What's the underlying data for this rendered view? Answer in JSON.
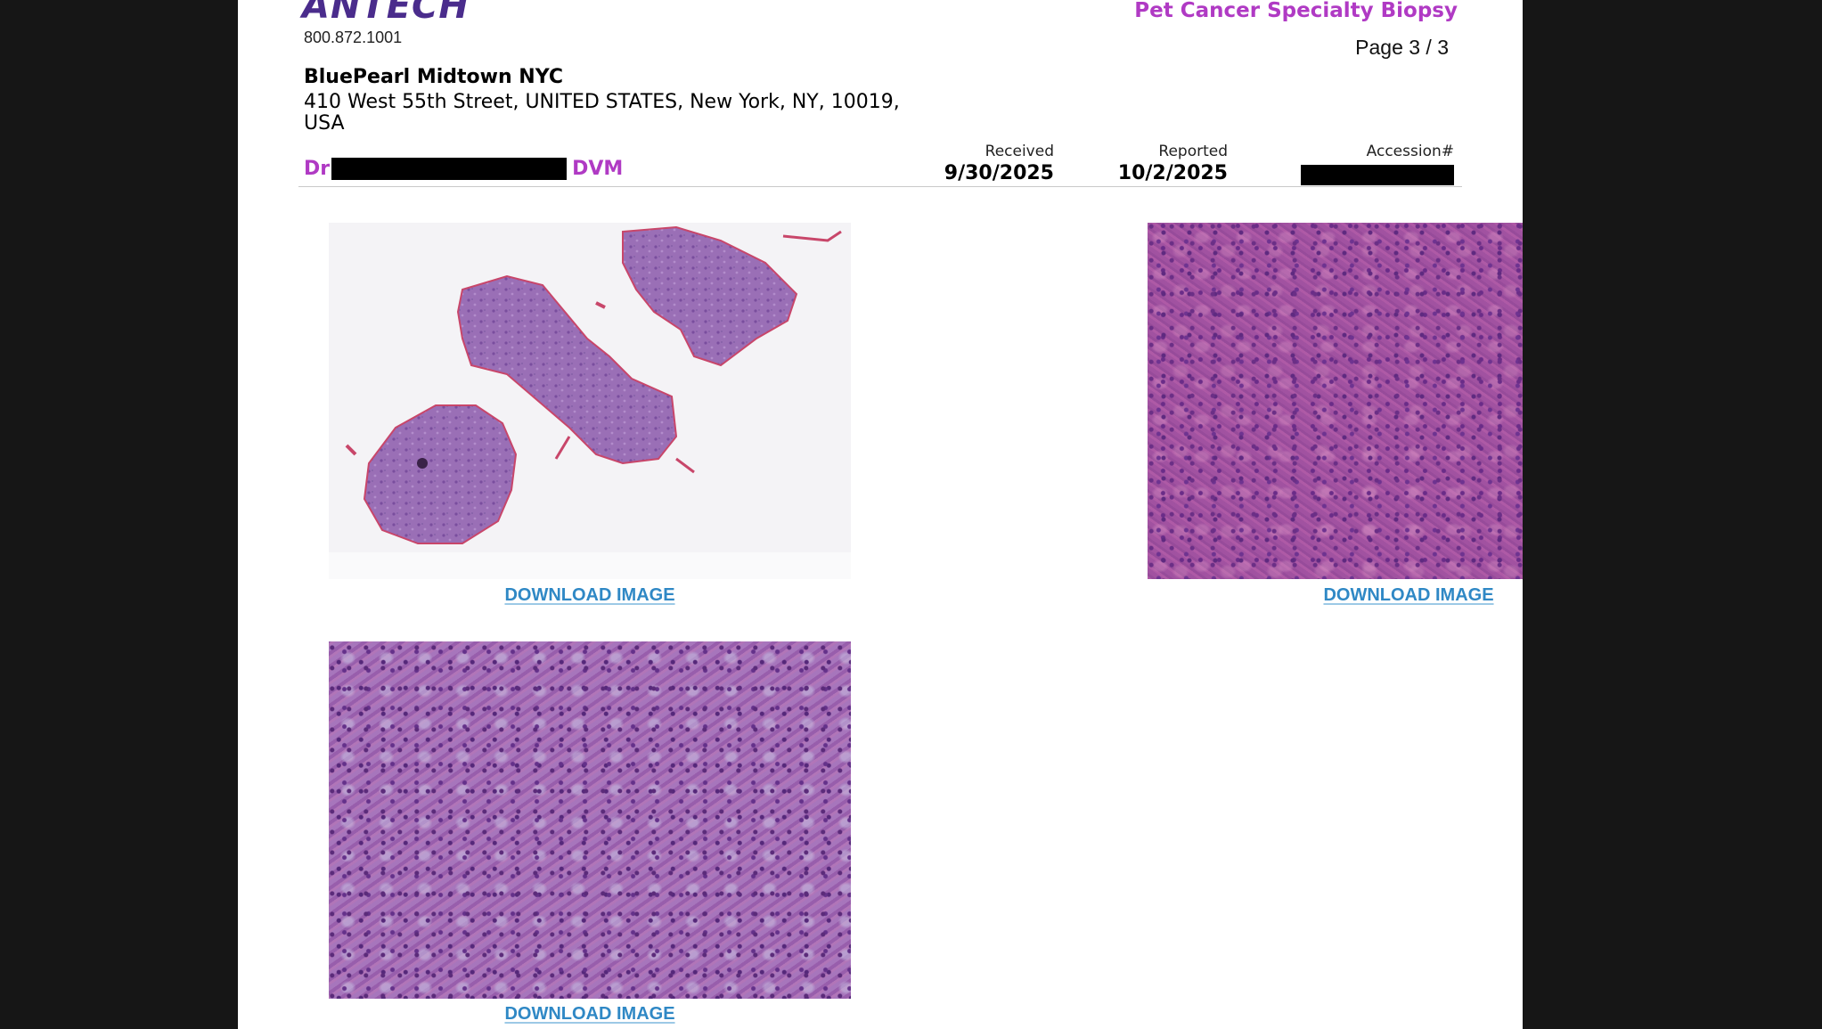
{
  "header": {
    "logo_text": "ANTECH",
    "phone": "800.872.1001",
    "report_title": "Pet Cancer Specialty Biopsy",
    "page_indicator": "Page 3 / 3"
  },
  "clinic": {
    "name": "BluePearl Midtown NYC",
    "address": "410 West 55th Street, UNITED STATES, New York, NY, 10019, USA"
  },
  "doctor": {
    "prefix": "Dr",
    "suffix": "DVM"
  },
  "meta": {
    "received_label": "Received",
    "received_value": "9/30/2025",
    "reported_label": "Reported",
    "reported_value": "10/2/2025",
    "accession_label": "Accession#"
  },
  "images": [
    {
      "download_label": "DOWNLOAD IMAGE"
    },
    {
      "download_label": "DOWNLOAD IMAGE"
    },
    {
      "download_label": "DOWNLOAD IMAGE"
    }
  ],
  "colors": {
    "brand_purple": "#4a2c8c",
    "accent_magenta": "#b03ac4",
    "link_blue": "#2f88c5"
  }
}
